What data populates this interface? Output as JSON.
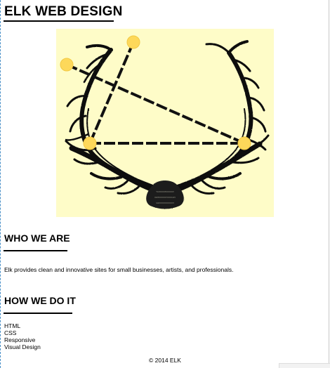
{
  "header": {
    "title": "ELK WEB DESIGN"
  },
  "hero": {
    "illustration": "elk-antlers-with-triangle-constellation",
    "background_color": "#fefcc8",
    "dot_color": "#fdd85a"
  },
  "about": {
    "heading": "WHO WE ARE",
    "text": "Elk provides clean and innovative sites for small businesses, artists, and professionals."
  },
  "process": {
    "heading": "HOW WE DO IT",
    "items": [
      "HTML",
      "CSS",
      "Responsive",
      "Visual Design"
    ]
  },
  "footer": {
    "copyright": "© 2014 ELK"
  }
}
